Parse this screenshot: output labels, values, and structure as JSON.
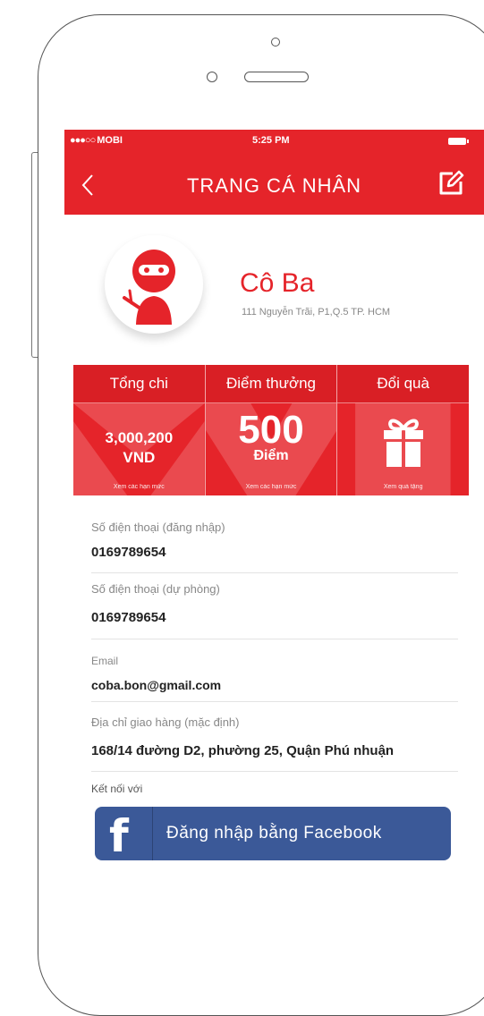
{
  "status_bar": {
    "carrier": "MOBI",
    "time": "5:25 PM"
  },
  "nav": {
    "title": "TRANG CÁ NHÂN",
    "back_icon": "chevron-left-icon",
    "edit_icon": "edit-icon"
  },
  "profile": {
    "name": "Cô Ba",
    "address": "111 Nguyễn Trãi, P1,Q.5 TP. HCM",
    "avatar_icon": "ninja-icon"
  },
  "stats": [
    {
      "title": "Tổng chi",
      "value": "3,000,200",
      "unit": "VND",
      "link": "Xem các hạn mức"
    },
    {
      "title": "Điểm thưởng",
      "value": "500",
      "unit": "Điểm",
      "link": "Xem các hạn mức"
    },
    {
      "title": "Đổi quà",
      "icon": "gift-icon",
      "link": "Xem quà tặng"
    }
  ],
  "fields": [
    {
      "label": "Số điện thoại (đăng nhập)",
      "value": "0169789654"
    },
    {
      "label": "Số điện thoại (dự phòng)",
      "value": "0169789654"
    },
    {
      "label": "Email",
      "value": "coba.bon@gmail.com"
    },
    {
      "label": "Địa chỉ giao hàng (mặc định)",
      "value": "168/14 đường D2, phường 25, Quận Phú nhuận"
    }
  ],
  "connect": {
    "label": "Kết nối với",
    "facebook_button": "Đăng nhập bằng Facebook"
  },
  "colors": {
    "primary": "#e5242a",
    "facebook": "#3b5998"
  }
}
